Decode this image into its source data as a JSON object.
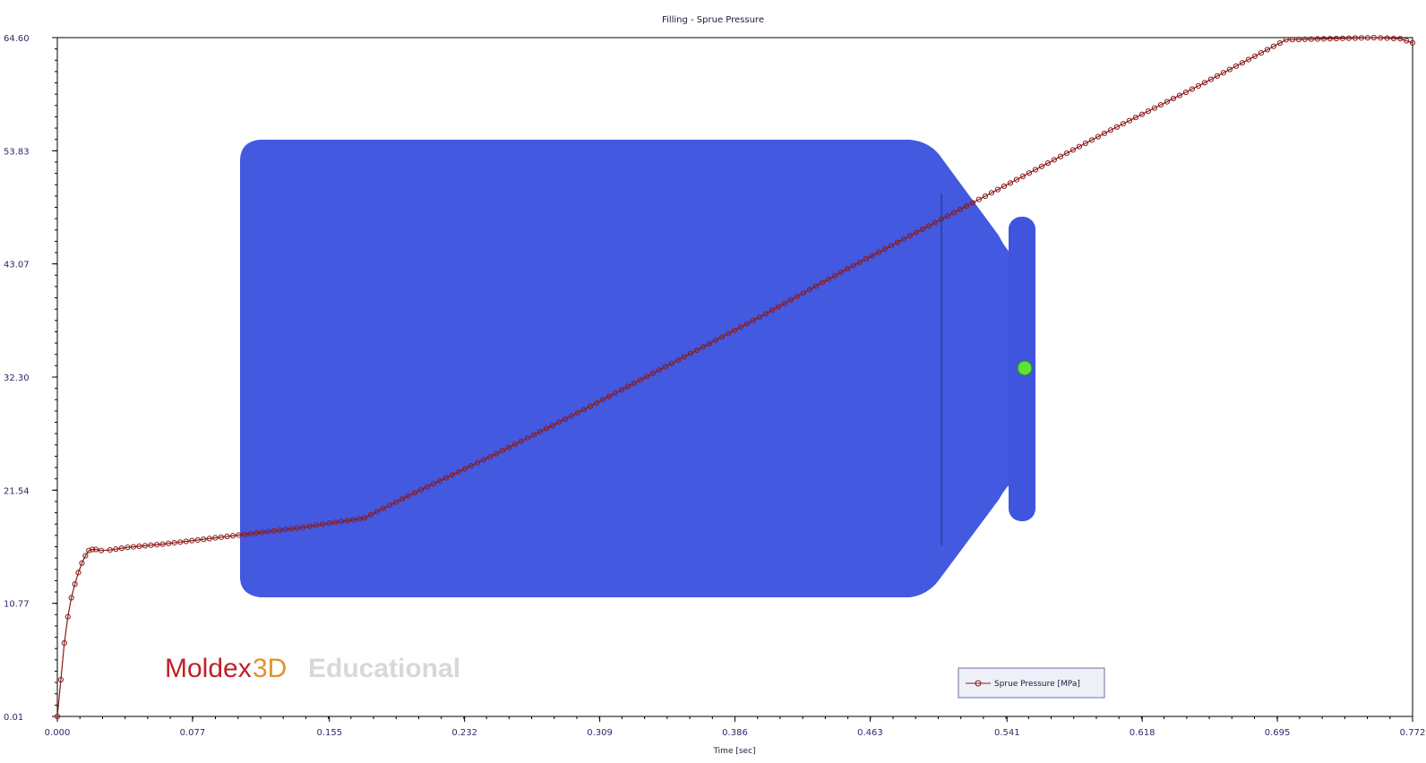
{
  "chart_data": {
    "type": "line",
    "title": "Filling - Sprue Pressure",
    "xlabel": "Time [sec]",
    "ylabel": "",
    "xlim": [
      0.0,
      0.772
    ],
    "ylim": [
      0.01,
      64.6
    ],
    "x_ticks": [
      "0.000",
      "0.077",
      "0.155",
      "0.232",
      "0.309",
      "0.386",
      "0.463",
      "0.541",
      "0.618",
      "0.695",
      "0.772"
    ],
    "y_ticks": [
      "0.01",
      "10.77",
      "21.54",
      "32.30",
      "43.07",
      "53.83",
      "64.60"
    ],
    "legend_position": "bottom-right",
    "grid": false,
    "series": [
      {
        "name": "Sprue Pressure [MPa]",
        "color": "#8b1a1a",
        "marker": "circle",
        "x": [
          0.0,
          0.002,
          0.004,
          0.006,
          0.008,
          0.01,
          0.012,
          0.014,
          0.016,
          0.018,
          0.02,
          0.022,
          0.025,
          0.03,
          0.04,
          0.06,
          0.08,
          0.1,
          0.12,
          0.14,
          0.155,
          0.172,
          0.175,
          0.2,
          0.25,
          0.3,
          0.35,
          0.4,
          0.45,
          0.5,
          0.55,
          0.6,
          0.65,
          0.7,
          0.75,
          0.765,
          0.772
        ],
        "y": [
          0.01,
          3.5,
          7.0,
          9.5,
          11.3,
          12.6,
          13.7,
          14.6,
          15.3,
          15.8,
          15.9,
          15.9,
          15.8,
          15.85,
          16.1,
          16.4,
          16.8,
          17.2,
          17.6,
          18.0,
          18.4,
          18.8,
          18.9,
          21.0,
          25.0,
          29.2,
          33.6,
          38.0,
          42.6,
          47.0,
          51.4,
          55.8,
          60.0,
          64.4,
          64.6,
          64.5,
          64.1
        ]
      }
    ]
  },
  "background_image": {
    "description_icon": "part-model-render",
    "part_color": "#4359e0",
    "gate_color": "#5fe03a"
  },
  "watermark": {
    "brand_red": "Moldex",
    "brand_orange": "3D",
    "edition": "Educational"
  }
}
